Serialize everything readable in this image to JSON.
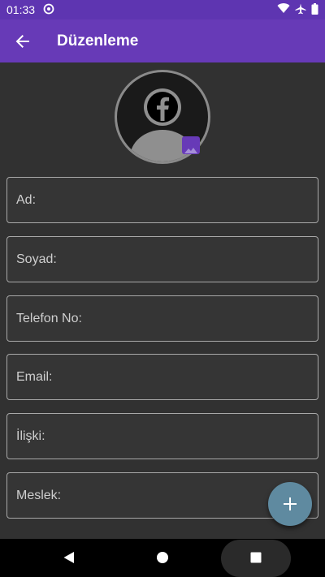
{
  "status_bar": {
    "time": "01:33",
    "icons": [
      "data-saver-icon",
      "wifi-icon",
      "airplane-icon",
      "battery-icon"
    ]
  },
  "app_bar": {
    "title": "Düzenleme",
    "back_icon": "arrow-back-icon"
  },
  "avatar": {
    "badge_icon": "image-icon",
    "logo": "facebook-logo",
    "accent": "#673ab7"
  },
  "form": {
    "fields": [
      {
        "label": "Ad:"
      },
      {
        "label": "Soyad:"
      },
      {
        "label": "Telefon No:"
      },
      {
        "label": "Email:"
      },
      {
        "label": "İlişki:"
      },
      {
        "label": "Meslek:"
      }
    ]
  },
  "fab": {
    "icon": "plus-icon",
    "color": "#5f8aa0"
  },
  "nav_bar": {
    "icons": [
      "back-triangle-icon",
      "home-circle-icon",
      "recents-square-icon"
    ]
  },
  "colors": {
    "primary": "#673ab7",
    "primary_dark": "#5e35b1",
    "background": "#303030"
  }
}
